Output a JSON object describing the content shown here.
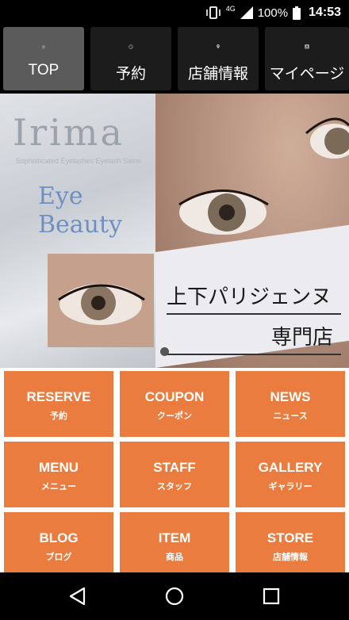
{
  "status": {
    "network": "4G",
    "battery": "100%",
    "time": "14:53"
  },
  "nav": {
    "tabs": [
      {
        "label": "TOP",
        "icon": "home-icon",
        "active": true
      },
      {
        "label": "予約",
        "icon": "clock-icon",
        "active": false
      },
      {
        "label": "店舗情報",
        "icon": "location-pin-icon",
        "active": false
      },
      {
        "label": "マイページ",
        "icon": "user-card-icon",
        "active": false
      }
    ]
  },
  "hero": {
    "brand": "Irima",
    "brand_sub": "Sophisticated Eyelashes Eyelash Salon",
    "eye_line1": "Eye",
    "eye_line2": "Beauty",
    "caption_line1": "上下パリジェンヌ",
    "caption_line2": "専門店"
  },
  "menu": {
    "tiles": [
      {
        "en": "RESERVE",
        "jp": "予約"
      },
      {
        "en": "COUPON",
        "jp": "クーポン"
      },
      {
        "en": "NEWS",
        "jp": "ニュース"
      },
      {
        "en": "MENU",
        "jp": "メニュー"
      },
      {
        "en": "STAFF",
        "jp": "スタッフ"
      },
      {
        "en": "GALLERY",
        "jp": "ギャラリー"
      },
      {
        "en": "BLOG",
        "jp": "ブログ"
      },
      {
        "en": "ITEM",
        "jp": "商品"
      },
      {
        "en": "STORE",
        "jp": "店舗情報"
      }
    ]
  },
  "colors": {
    "tile": "#ea7c3f",
    "nav_active": "#5b5b5b",
    "nav_bg": "#000000"
  }
}
